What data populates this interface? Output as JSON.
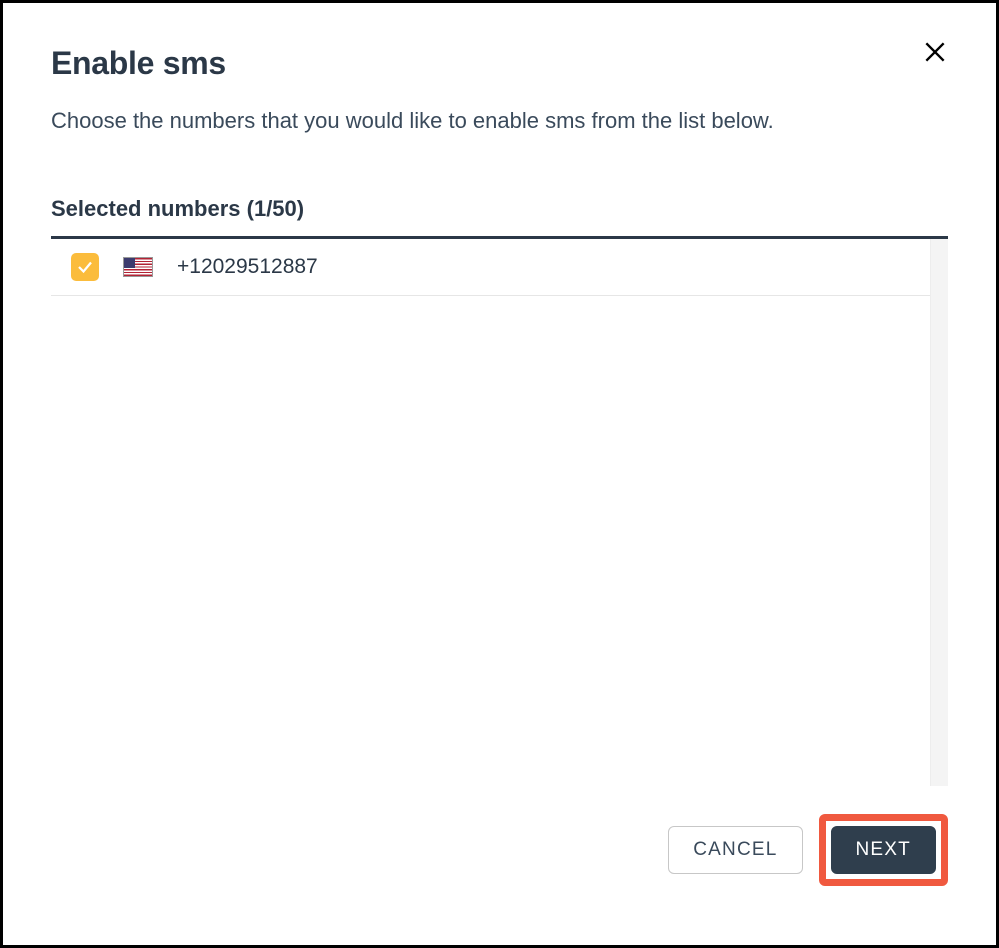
{
  "modal": {
    "title": "Enable sms",
    "subtitle": "Choose the numbers that you would like to enable sms from the list below.",
    "section_heading": "Selected numbers (1/50)"
  },
  "numbers": [
    {
      "country": "us",
      "phone": "+12029512887",
      "checked": true
    }
  ],
  "footer": {
    "cancel_label": "CANCEL",
    "next_label": "NEXT"
  }
}
